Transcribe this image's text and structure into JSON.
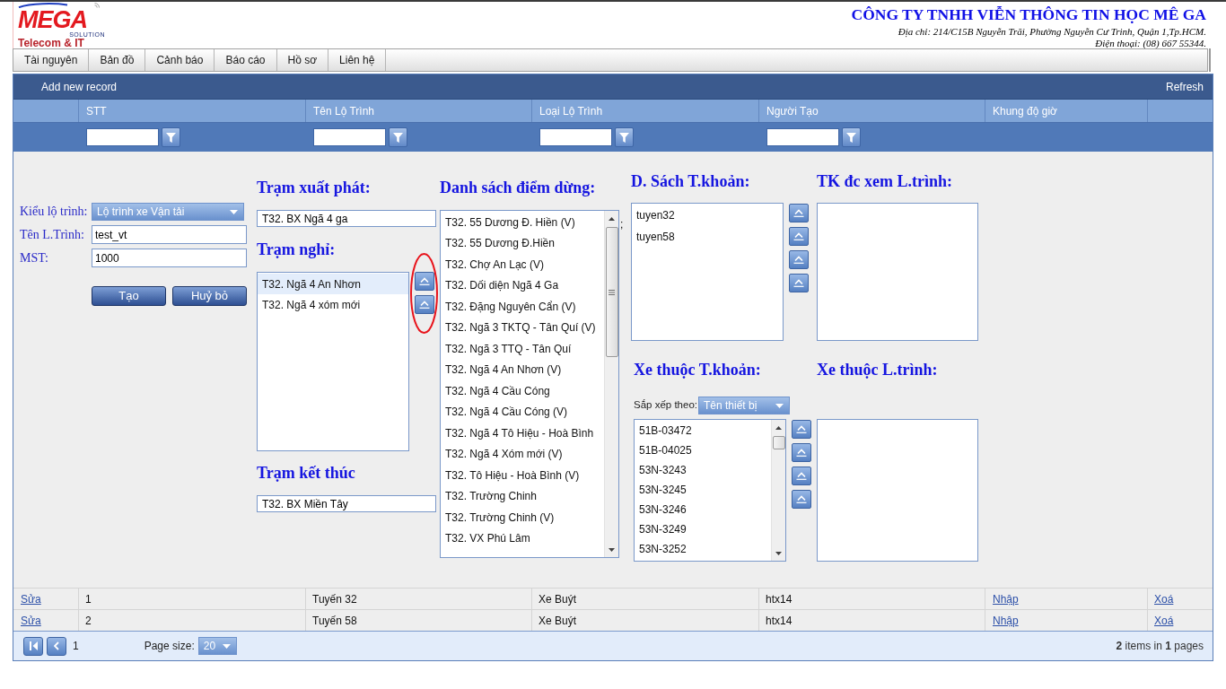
{
  "header": {
    "logo": {
      "wordmark": "MEGA",
      "tagline": "SOLUTION",
      "subtitle": "Telecom & IT"
    },
    "company": "CÔNG TY TNHH VIỄN THÔNG TIN HỌC MÊ GA",
    "address": "Địa chỉ: 214/C15B Nguyễn Trãi, Phường Nguyễn Cư Trinh, Quận 1,Tp.HCM.",
    "phone": "Điện thoại: (08) 667 55344."
  },
  "menu": [
    "Tài nguyên",
    "Bản đồ",
    "Cảnh báo",
    "Báo cáo",
    "Hồ sơ",
    "Liên hệ"
  ],
  "grid": {
    "toolbar": {
      "add": "Add new record",
      "refresh": "Refresh"
    },
    "columns": [
      {
        "label": "STT",
        "filter": true
      },
      {
        "label": "Tên Lộ Trình",
        "filter": true
      },
      {
        "label": "Loại Lộ Trình",
        "filter": true
      },
      {
        "label": "Người Tạo",
        "filter": true
      },
      {
        "label": "Khung độ giờ",
        "filter": false
      }
    ],
    "edit_form": {
      "fields": [
        {
          "kind": "dropdown",
          "label": "Kiểu lộ trình:",
          "value": "Lộ trình xe Vận tải"
        },
        {
          "kind": "text",
          "label": "Tên L.Trình:",
          "value": "test_vt"
        },
        {
          "kind": "text",
          "label": "MST:",
          "value": "1000"
        }
      ],
      "buttons": [
        "Tạo",
        "Huỷ bỏ"
      ],
      "start_station": {
        "title": "Trạm xuất phát:",
        "value": "T32. BX Ngã 4 ga"
      },
      "rest_stops": {
        "title": "Trạm nghỉ:",
        "items": [
          {
            "label": "T32. Ngã 4 An Nhơn",
            "selected": true
          },
          {
            "label": "T32. Ngã 4 xóm mới",
            "selected": false
          }
        ]
      },
      "end_station": {
        "title": "Trạm kết thúc",
        "value": "T32. BX Miền Tây"
      },
      "stops": {
        "title": "Danh sách điểm dừng:",
        "items": [
          {
            "label": "T32. 55 Dương Đ. Hiền (V)",
            "selected": false
          },
          {
            "label": "T32. 55 Dương Đ.Hiền",
            "selected": false
          },
          {
            "label": "T32. Chợ An Lạc (V)",
            "selected": false
          },
          {
            "label": "T32. Dối diện Ngã 4 Ga",
            "selected": false
          },
          {
            "label": "T32. Đặng Nguyên Cẩn (V)",
            "selected": false
          },
          {
            "label": "T32. Ngã 3 TKTQ - Tân Quí (V)",
            "selected": false
          },
          {
            "label": "T32. Ngã 3 TTQ - Tân Quí",
            "selected": false
          },
          {
            "label": "T32. Ngã 4 An Nhơn (V)",
            "selected": false
          },
          {
            "label": "T32. Ngã 4 Cầu Cóng",
            "selected": false
          },
          {
            "label": "T32. Ngã 4 Cầu Cóng (V)",
            "selected": false
          },
          {
            "label": "T32. Ngã 4 Tô Hiệu - Hoà Bình",
            "selected": false
          },
          {
            "label": "T32. Ngã 4 Xóm mới (V)",
            "selected": false
          },
          {
            "label": "T32. Tô Hiệu - Hoà Bình (V)",
            "selected": false
          },
          {
            "label": "T32. Trường Chinh",
            "selected": false
          },
          {
            "label": "T32. Trường Chinh (V)",
            "selected": false
          },
          {
            "label": "T32. VX Phú Lâm",
            "selected": false
          }
        ]
      },
      "stray_mark": ";",
      "accounts": {
        "title": "D. Sách T.khoản:",
        "items": [
          {
            "label": "tuyen32",
            "selected": false
          },
          {
            "label": "tuyen58",
            "selected": false
          }
        ]
      },
      "route_viewers": {
        "title": "TK đc xem L.trình:"
      },
      "account_vehicles": {
        "title": "Xe thuộc T.khoản:",
        "sort_label": "Sắp xếp theo:",
        "sort_value": "Tên thiết bị",
        "items": [
          {
            "label": "51B-03472",
            "selected": false
          },
          {
            "label": "51B-04025",
            "selected": false
          },
          {
            "label": "53N-3243",
            "selected": false
          },
          {
            "label": "53N-3245",
            "selected": false
          },
          {
            "label": "53N-3246",
            "selected": false
          },
          {
            "label": "53N-3249",
            "selected": false
          },
          {
            "label": "53N-3252",
            "selected": false
          }
        ]
      },
      "route_vehicles": {
        "title": "Xe thuộc L.trình:"
      }
    },
    "rows": [
      {
        "edit": "Sửa",
        "cells": [
          "1",
          "Tuyến 32",
          "Xe Buýt",
          "htx14"
        ],
        "import": "Nhập",
        "delete": "Xoá"
      },
      {
        "edit": "Sửa",
        "cells": [
          "2",
          "Tuyến 58",
          "Xe Buýt",
          "htx14"
        ],
        "import": "Nhập",
        "delete": "Xoá"
      }
    ],
    "pager": {
      "page": "1",
      "page_size_label": "Page size:",
      "page_size": "20",
      "summary": "**2** items in **1** pages"
    }
  }
}
